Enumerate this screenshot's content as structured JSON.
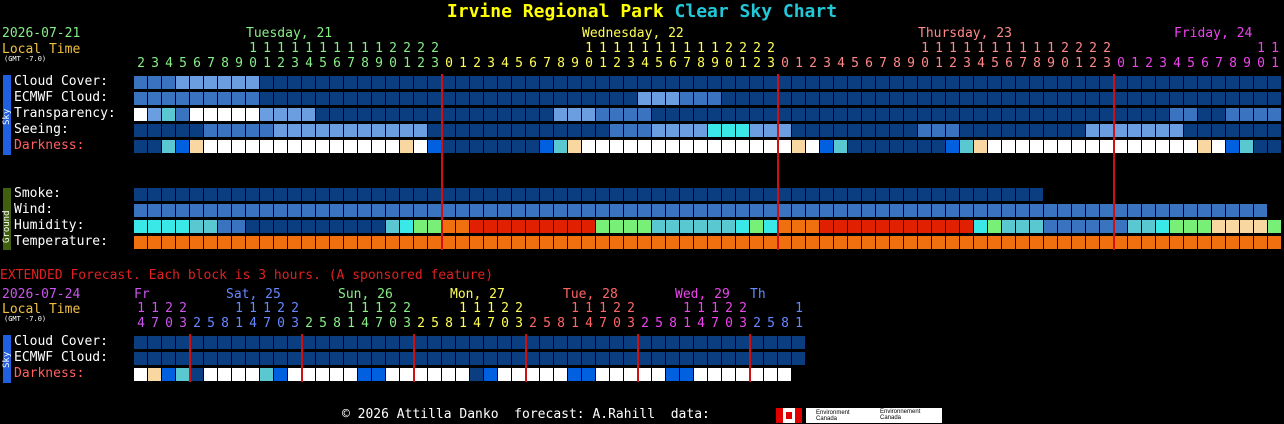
{
  "title": {
    "site": "Irvine Regional Park",
    "chart": "Clear Sky Chart",
    "site_color": "#ffff00",
    "chart_color": "#22c8d8"
  },
  "main": {
    "date": "2026-07-21",
    "local_time": "Local Time",
    "gmt": "(GMT -7.0)",
    "days": [
      {
        "label": "Tuesday, 21",
        "color": "#88ee88"
      },
      {
        "label": "Wednesday, 22",
        "color": "#ffff55"
      },
      {
        "label": "Thursday, 23",
        "color": "#ff8888"
      },
      {
        "label": "Friday, 24",
        "color": "#ee44ee"
      }
    ],
    "tens_color": "#88ee88",
    "hours": [
      2,
      3,
      4,
      5,
      6,
      7,
      8,
      9,
      10,
      11,
      12,
      13,
      14,
      15,
      16,
      17,
      18,
      19,
      20,
      21,
      22,
      23,
      0,
      1,
      2,
      3,
      4,
      5,
      6,
      7,
      8,
      9,
      10,
      11,
      12,
      13,
      14,
      15,
      16,
      17,
      18,
      19,
      20,
      21,
      22,
      23,
      0,
      1,
      2,
      3,
      4,
      5,
      6,
      7,
      8,
      9,
      10,
      11,
      12,
      13,
      14,
      15,
      16,
      17,
      18,
      19,
      20,
      21,
      22,
      23,
      0,
      1,
      2,
      3,
      4,
      5,
      6,
      7,
      8,
      9,
      10,
      11
    ],
    "sky_rows": [
      {
        "label": "Cloud Cover:",
        "color": "#fff",
        "values": "mmmllllllddddddddddddddddddddddddddddddddddddddddddddddddddddddddddddddddddddddddd"
      },
      {
        "label": "ECMWF Cloud:",
        "color": "#fff",
        "values": "mmmmmmmmmdddddddddddddddddddddddddddlllmmmdddddddddddddddddddddddddddddddddddddddddd"
      },
      {
        "label": "Transparency:",
        "color": "#fff",
        "values": "wlbmwwwwwlllldddddddddddddddddlllmmmmdddddddddddddddddddddddddddddddddddddmmddmmmmm"
      },
      {
        "label": "Seeing:",
        "color": "#fff",
        "values": "dddddmmmmmllllllllllldddddddddddddmmmllllcccllldddddddddmmmdddddddddlllllllddddddddd"
      },
      {
        "label": "Darkness:",
        "color": "#ff6060",
        "values": "ddbBywwwwwwwwwwwwwwywBdddddddBbywwwwwwwwwwwwwwwywBbdddddddBbywwwwwwwwwwwwwwwywBbdddddddBbywwwwww"
      }
    ],
    "ground_rows": [
      {
        "label": "Smoke:",
        "color": "#fff",
        "values": "ddddddddddddddddddddddddddddddddddddddddddddddddddddddddddddddddd"
      },
      {
        "label": "Wind:",
        "color": "#fff",
        "values": "mmmmmmmmmmmmmmmmmmmmmmmmmmmmmmmmmmmmmmmmmmmmmmmmmmmmmmmmmmmmmmmmmmmmmmmmmmmmmmmmm"
      },
      {
        "label": "Humidity:",
        "color": "#fff",
        "values": "ccccbbmmddddddddddbcggoorrrrrrrrrggggbbbbbbcgcooorrrrrrrrrrrcgbbbmmmmmmbbcgggyyyyggcbb"
      },
      {
        "label": "Temperature:",
        "color": "#fff",
        "values": "oooooooooooooooooooooooooooooooooooooooooooooooooooooooooooooooooooooooooooooooooo"
      }
    ],
    "sky_tag": "Sky",
    "ground_tag": "Ground"
  },
  "extended": {
    "notice": "EXTENDED Forecast. Each block is 3 hours. (A sponsored feature)",
    "date": "2026-07-24",
    "local_time": "Local Time",
    "gmt": "(GMT -7.0)",
    "days": [
      {
        "label": "Fr",
        "color": "#cc55ee"
      },
      {
        "label": "Sat, 25",
        "color": "#6688ff"
      },
      {
        "label": "Sun, 26",
        "color": "#88ee88"
      },
      {
        "label": "Mon, 27",
        "color": "#ffff55"
      },
      {
        "label": "Tue, 28",
        "color": "#ff6666"
      },
      {
        "label": "Wed, 29",
        "color": "#ee44ee"
      },
      {
        "label": "Th",
        "color": "#6688ff"
      }
    ],
    "hours": [
      14,
      17,
      20,
      23,
      2,
      5,
      8,
      11,
      14,
      17,
      20,
      23,
      2,
      5,
      8,
      11,
      14,
      17,
      20,
      23,
      2,
      5,
      8,
      11,
      14,
      17,
      20,
      23,
      2,
      5,
      8,
      11,
      14,
      17,
      20,
      23,
      2,
      5,
      8,
      11,
      14,
      17,
      20,
      23,
      2,
      5,
      8,
      11
    ],
    "rows": [
      {
        "label": "Cloud Cover:",
        "color": "#fff",
        "values": "dddddddddddddddddddddddddddddddddddddddddddddddd"
      },
      {
        "label": "ECMWF Cloud:",
        "color": "#fff",
        "values": "ddddddddddddddddddddddddddddddddddddddddddddddddd"
      },
      {
        "label": "Darkness:",
        "color": "#ff6060",
        "values": "wyBbdwwwwbBwwwwwBBwwwwwwdBwwwwwBBwwwwwBBwwwwwww"
      }
    ],
    "sky_tag": "Sky"
  },
  "footer": {
    "copyright": "© 2026 Attilla Danko  forecast: A.Rahill  data:",
    "agency_en": "Environment Canada",
    "agency_fr": "Environnement Canada"
  },
  "palette": {
    "w": "#ffffff",
    "y": "#f8d8a0",
    "l": "#6a9ee0",
    "m": "#3a74c0",
    "d": "#0a3e80",
    "b": "#5ac8d0",
    "B": "#0060e0",
    "c": "#3ae8e8",
    "g": "#78f078",
    "o": "#f07010",
    "r": "#e02000"
  }
}
